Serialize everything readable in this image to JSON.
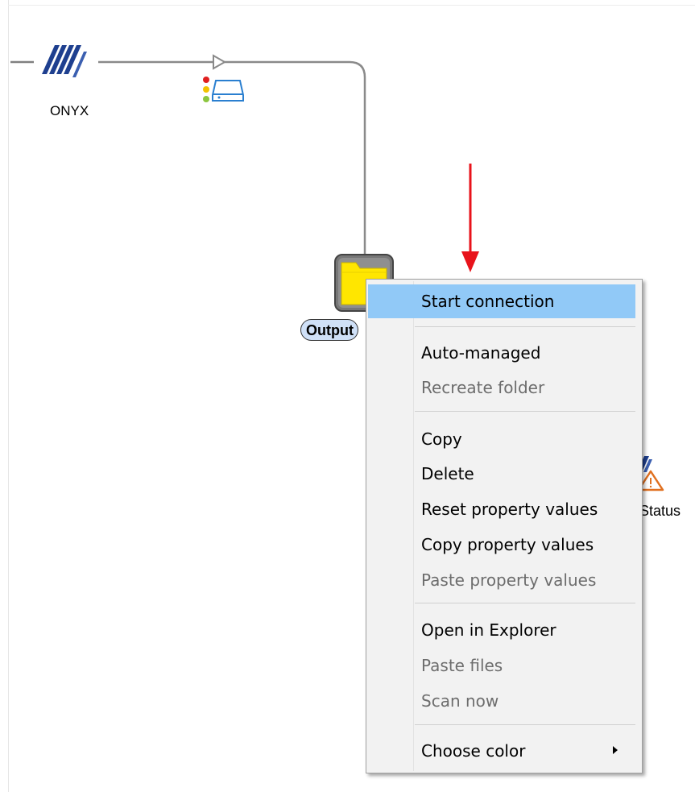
{
  "canvas": {
    "nodes": {
      "onyx_label": "ONYX",
      "output_label": "Output",
      "status_label": "Status"
    }
  },
  "context_menu": {
    "items": [
      {
        "label": "Start connection",
        "enabled": true,
        "highlighted": true
      },
      {
        "label": "Auto-managed",
        "enabled": true
      },
      {
        "label": "Recreate folder",
        "enabled": false
      },
      {
        "label": "Copy",
        "enabled": true
      },
      {
        "label": "Delete",
        "enabled": true
      },
      {
        "label": "Reset property values",
        "enabled": true
      },
      {
        "label": "Copy property values",
        "enabled": true
      },
      {
        "label": "Paste property values",
        "enabled": false
      },
      {
        "label": "Open in Explorer",
        "enabled": true
      },
      {
        "label": "Paste files",
        "enabled": false
      },
      {
        "label": "Scan now",
        "enabled": false
      },
      {
        "label": "Choose color",
        "enabled": true,
        "submenu": true
      }
    ]
  },
  "colors": {
    "highlight": "#91c9f7",
    "folder_yellow": "#ffe600",
    "arrow_red": "#e8131b",
    "onyx_blue": "#1e3f8f"
  },
  "icons": [
    "onyx-logo-icon",
    "traffic-light-icon",
    "disk-icon",
    "folder-icon",
    "warning-icon",
    "red-arrow-icon",
    "submenu-arrow-icon"
  ]
}
